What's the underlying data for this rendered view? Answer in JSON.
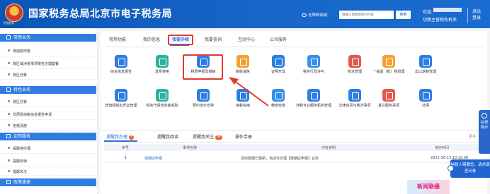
{
  "header": {
    "title": "国家税务总局北京市电子税务局",
    "emblem_caption": "中国税务",
    "accessibility_label": "无障碍阅读",
    "search_placeholder": "请输入需要搜索的内容",
    "search_button": "搜索",
    "welcome": "欢迎,",
    "switch_link": "切换主管税务机关",
    "logout": "退出登录"
  },
  "sidebar": {
    "sections": [
      {
        "title": "常用业务",
        "items": [
          "增值税申报",
          "跨区域涉税事项报告办理套餐",
          "跨区迁移"
        ]
      },
      {
        "title": "特色业务",
        "items": [
          "跨区迁移",
          "非居民纳税信息报告申请",
          "定税清册"
        ]
      },
      {
        "title": "定制服务",
        "items": [
          "提醒待办理",
          "提醒阅读",
          "提醒关注"
        ]
      },
      {
        "title": "政策速递",
        "items": []
      }
    ]
  },
  "main": {
    "tabs": [
      "常用功能",
      "我的信息",
      "我要办税",
      "我要查询",
      "互动中心",
      "公众服务"
    ],
    "active_tab": "我要办税",
    "tiles": [
      {
        "label": "综合信息报告",
        "icon": "info-report-icon",
        "color": "#2f7de1"
      },
      {
        "label": "发票使用",
        "icon": "invoice-icon",
        "color": "#2db3a0"
      },
      {
        "label": "税费申报及缴纳",
        "icon": "tax-declare-pay-icon",
        "color": "#2f7de1"
      },
      {
        "label": "税收减免",
        "icon": "tax-reduction-icon",
        "color": "#f2a233"
      },
      {
        "label": "证明开具",
        "icon": "certificate-icon",
        "color": "#2f7de1"
      },
      {
        "label": "税务行政许可",
        "icon": "admin-permit-icon",
        "color": "#3a8ee6"
      },
      {
        "label": "核定管理",
        "icon": "approval-mgmt-icon",
        "color": "#e25a4c"
      },
      {
        "label": "一般退（抵）税管理",
        "icon": "tax-refund-icon",
        "color": "#f2a233"
      },
      {
        "label": "出口退税管理",
        "icon": "export-refund-icon",
        "color": "#2f7de1"
      },
      {
        "label": "增值税抵扣凭证管理",
        "icon": "vat-voucher-icon",
        "color": "#2f7de1"
      },
      {
        "label": "税务代保管资金收取",
        "icon": "custody-fund-icon",
        "color": "#2db3a0"
      },
      {
        "label": "预约定价安排",
        "icon": "pricing-arrangement-icon",
        "color": "#2f7de1"
      },
      {
        "label": "纳税信用",
        "icon": "tax-credit-icon",
        "color": "#2f7de1"
      },
      {
        "label": "稽查检查",
        "icon": "inspection-icon",
        "color": "#3a8ee6"
      },
      {
        "label": "涉税专业服务机构管理",
        "icon": "tax-agency-icon",
        "color": "#2f7de1"
      },
      {
        "label": "法律追责与救济事项",
        "icon": "legal-remedy-icon",
        "color": "#2f7de1"
      },
      {
        "label": "其它服务事项",
        "icon": "other-services-icon",
        "color": "#e25a4c"
      },
      {
        "label": "社保",
        "icon": "social-security-icon",
        "color": "#2f7de1"
      }
    ],
    "highlighted_tile": "税费申报及缴纳"
  },
  "panel": {
    "tabs": [
      {
        "label": "提醒我办理",
        "badge": "1"
      },
      {
        "label": "提醒我阅读",
        "badge": ""
      },
      {
        "label": "提醒我关注",
        "badge": "68"
      },
      {
        "label": "操作手册",
        "badge": ""
      }
    ],
    "more": "更多",
    "columns": [
      "序号",
      "事项名称",
      "内容说明",
      "待办时间"
    ],
    "rows": [
      {
        "index": "1",
        "name": "按期应申报",
        "description": "您的数据已更新，当前可办理【按期应申报】业务",
        "time": "2022-10-13 10:12:08"
      }
    ]
  },
  "widgets": {
    "online_help": "在线导办",
    "chat_banner": "纳税人需要您，请求调查问卷",
    "promo": "新闻联播"
  }
}
